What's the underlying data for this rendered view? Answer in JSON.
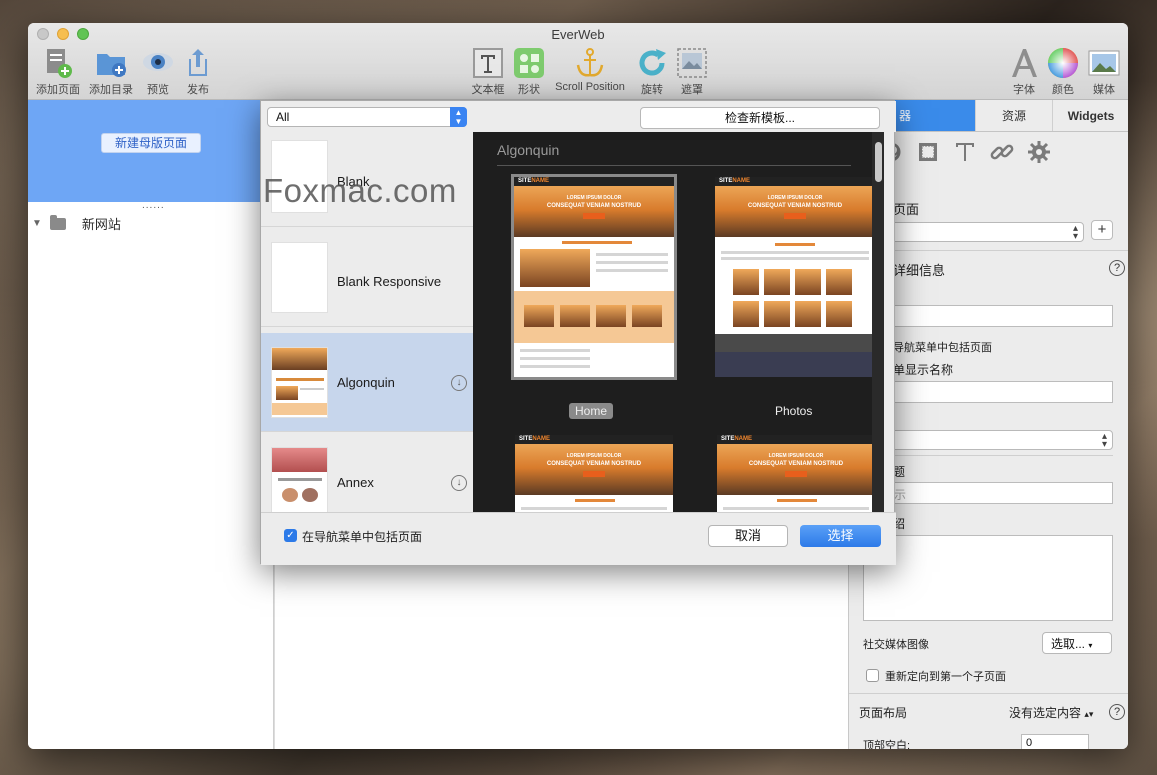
{
  "window": {
    "title": "EverWeb"
  },
  "toolbar": {
    "left": [
      {
        "label": "添加页面",
        "icon": "add-page-icon"
      },
      {
        "label": "添加目录",
        "icon": "add-folder-icon"
      },
      {
        "label": "预览",
        "icon": "eye-icon"
      },
      {
        "label": "发布",
        "icon": "share-icon"
      }
    ],
    "center": [
      {
        "label": "文本框",
        "icon": "text-box-icon"
      },
      {
        "label": "形状",
        "icon": "shapes-icon"
      },
      {
        "label": "Scroll Position",
        "icon": "anchor-icon"
      },
      {
        "label": "旋转",
        "icon": "rotate-icon"
      },
      {
        "label": "遮罩",
        "icon": "mask-icon"
      }
    ],
    "right": [
      {
        "label": "字体",
        "icon": "font-icon"
      },
      {
        "label": "颜色",
        "icon": "color-wheel-icon"
      },
      {
        "label": "媒体",
        "icon": "media-icon"
      }
    ]
  },
  "left_pane": {
    "new_master_button": "新建母版页面",
    "splitter": "......",
    "site_name": "新网站"
  },
  "inspector": {
    "tabs": [
      "检查器",
      "资源",
      "Widgets"
    ],
    "tab_visible_text": "器",
    "page_label": "页面",
    "details_label": "详细信息",
    "nav_include_label": "导航菜单中包括页面",
    "menu_display_name_label": "单显示名称",
    "title_label": "题",
    "title_placeholder": "器顶部显示",
    "intro_label": "绍",
    "social_image_label": "社交媒体图像",
    "choose_button": "选取...",
    "redirect_label": "重新定向到第一个子页面",
    "layout_label": "页面布局",
    "no_selection": "没有选定内容",
    "top_space_label": "顶部空白:",
    "top_space_value": "0"
  },
  "dialog": {
    "filter": "All",
    "check_new_button": "检查新模板...",
    "watermark": "Foxmac.com",
    "templates": [
      {
        "name": "Blank"
      },
      {
        "name": "Blank Responsive"
      },
      {
        "name": "Algonquin"
      },
      {
        "name": "Annex"
      }
    ],
    "preview_title": "Algonquin",
    "pages": [
      {
        "caption": "Home",
        "hero_line1": "LOREM IPSUM DOLOR",
        "hero_line2": "CONSEQUAT VENIAM NOSTRUD"
      },
      {
        "caption": "Photos",
        "hero_line1": "LOREM IPSUM DOLOR",
        "hero_line2": "CONSEQUAT VENIAM NOSTRUD"
      },
      {
        "caption": "",
        "hero_line1": "LOREM IPSUM DOLOR",
        "hero_line2": "CONSEQUAT VENIAM NOSTRUD"
      },
      {
        "caption": "",
        "hero_line1": "LOREM IPSUM DOLOR",
        "hero_line2": "CONSEQUAT VENIAM NOSTRUD"
      }
    ],
    "thumb_logo_a": "SITE",
    "thumb_logo_b": "NAME",
    "include_nav_label": "在导航菜单中包括页面",
    "cancel": "取消",
    "choose": "选择"
  },
  "colors": {
    "accent": "#3a8bea",
    "master_area": "#6ea6f5",
    "selected_template": "#c7d6ec",
    "preview_bg": "#1e1e1e"
  }
}
